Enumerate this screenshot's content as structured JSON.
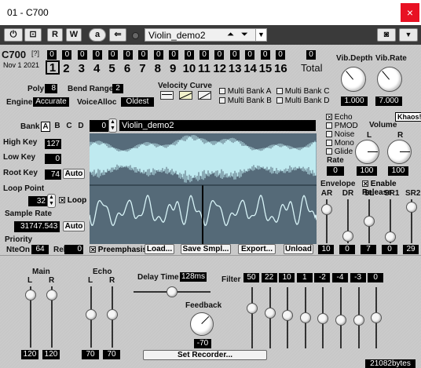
{
  "window": {
    "title": "01 - C700",
    "close_glyph": "×"
  },
  "toolbar": {
    "r_label": "R",
    "w_label": "W",
    "a_label": "a",
    "preset_name": "Violin_demo2"
  },
  "header": {
    "product": "C700",
    "help": "[?]",
    "date": "Nov  1 2021",
    "total_label": "Total",
    "total_value": "0",
    "parts": [
      "1",
      "2",
      "3",
      "4",
      "5",
      "6",
      "7",
      "8",
      "9",
      "10",
      "11",
      "12",
      "13",
      "14",
      "15",
      "16"
    ],
    "part_counts": [
      "0",
      "0",
      "0",
      "0",
      "0",
      "0",
      "0",
      "0",
      "0",
      "0",
      "0",
      "0",
      "0",
      "0",
      "0",
      "0"
    ],
    "selected_part": "1"
  },
  "vibrato": {
    "depth_label": "Vib.Depth",
    "rate_label": "Vib.Rate",
    "depth_value": "1.000",
    "rate_value": "7.000"
  },
  "voice": {
    "poly_label": "Poly",
    "poly_value": "8",
    "bend_label": "Bend Range",
    "bend_value": "2",
    "engine_label": "Engine",
    "engine_value": "Accurate",
    "voicealloc_label": "VoiceAlloc",
    "voicealloc_value": "Oldest"
  },
  "velocity": {
    "label": "Velocity Curve"
  },
  "multibank": [
    "Multi Bank A",
    "Multi Bank B",
    "Multi Bank C",
    "Multi Bank D"
  ],
  "bank": {
    "label": "Bank",
    "items": [
      "A",
      "B",
      "C",
      "D"
    ],
    "selected": "A",
    "program": "0",
    "sample_name": "Violin_demo2"
  },
  "sample": {
    "highkey_label": "High Key",
    "highkey": "127",
    "lowkey_label": "Low Key",
    "lowkey": "0",
    "rootkey_label": "Root Key",
    "rootkey": "74",
    "auto1": "Auto",
    "looppoint_label": "Loop Point",
    "looppoint": "32",
    "loop_label": "Loop",
    "samplerate_label": "Sample Rate",
    "samplerate": "31747.543",
    "auto2": "Auto",
    "priority_label": "Priority",
    "nteon_label": "NteOn",
    "nteon": "64",
    "rel_label": "Rel",
    "rel": "0",
    "preemph_label": "Preemphasis"
  },
  "actions": {
    "load": "Load...",
    "save": "Save Smpl...",
    "export": "Export...",
    "unload": "Unload"
  },
  "flags": {
    "items": [
      "Echo",
      "PMOD",
      "Noise",
      "Mono",
      "Glide"
    ],
    "checked": [
      "Echo"
    ],
    "rate_label": "Rate",
    "rate_value": "0",
    "khaos": "Khaos!"
  },
  "volume": {
    "label": "Volume",
    "l_label": "L",
    "r_label": "R",
    "l_value": "100",
    "r_value": "100"
  },
  "envelope": {
    "label": "Envelope",
    "enable_release": "Enable Release",
    "labels": [
      "AR",
      "DR",
      "SL",
      "SR1",
      "SR2"
    ],
    "values": [
      "10",
      "0",
      "7",
      "0",
      "29"
    ],
    "levels": [
      0.85,
      0.05,
      0.5,
      0.02,
      0.93
    ]
  },
  "echo_section": {
    "main_label": "Main",
    "echo_label": "Echo",
    "l": "L",
    "r": "R",
    "main_values": [
      "120",
      "120"
    ],
    "echo_values": [
      "70",
      "70"
    ],
    "main_levels": [
      0.94,
      0.94
    ],
    "echo_levels": [
      0.55,
      0.55
    ],
    "delay_label": "Delay Time",
    "delay_value": "128ms",
    "feedback_label": "Feedback",
    "feedback_value": "-70",
    "setrec": "Set Recorder..."
  },
  "filter": {
    "label": "Filter",
    "values": [
      "50",
      "22",
      "10",
      "1",
      "-2",
      "-4",
      "-3",
      "0"
    ],
    "levels": [
      0.69,
      0.59,
      0.55,
      0.5,
      0.48,
      0.45,
      0.46,
      0.5
    ]
  },
  "status": {
    "bytes": "21082bytes"
  }
}
